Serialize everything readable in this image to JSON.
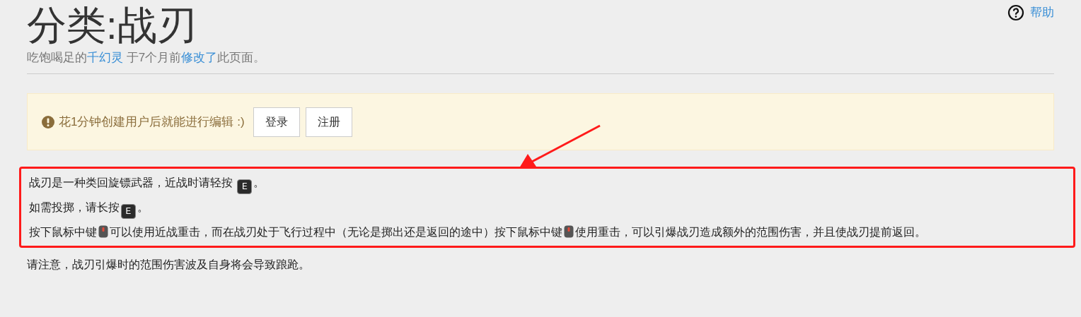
{
  "title": "分类:战刃",
  "byline": [
    {
      "kind": "text",
      "text": "吃饱喝足的"
    },
    {
      "kind": "link",
      "text": "千幻灵"
    },
    {
      "kind": "text",
      "text": " 于7个月前"
    },
    {
      "kind": "link",
      "text": "修改了"
    },
    {
      "kind": "text",
      "text": "此页面。"
    }
  ],
  "help": {
    "label": "帮助"
  },
  "notice": {
    "text": "花1分钟创建用户后就能进行编辑 :)",
    "buttons": [
      "登录",
      "注册"
    ]
  },
  "highlighted_paragraphs": [
    [
      {
        "kind": "text",
        "text": "战刃是一种类回旋镖武器，近战时请轻按 "
      },
      {
        "kind": "key",
        "text": "E"
      },
      {
        "kind": "text",
        "text": "。"
      }
    ],
    [
      {
        "kind": "text",
        "text": "如需投掷，请长按"
      },
      {
        "kind": "key",
        "text": "E"
      },
      {
        "kind": "text",
        "text": "。"
      }
    ],
    [
      {
        "kind": "text",
        "text": "按下鼠标中键"
      },
      {
        "kind": "mouse"
      },
      {
        "kind": "text",
        "text": "可以使用近战重击，而在战刃处于飞行过程中（无论是掷出还是返回的途中）按下鼠标中键"
      },
      {
        "kind": "mouse"
      },
      {
        "kind": "text",
        "text": "使用重击，可以引爆战刃造成额外的范围伤害，并且使战刃提前返回。"
      }
    ]
  ],
  "paragraphs": [
    [
      {
        "kind": "text",
        "text": "请注意，战刃引爆时的范围伤害波及自身将会导致踉跄。"
      }
    ]
  ]
}
